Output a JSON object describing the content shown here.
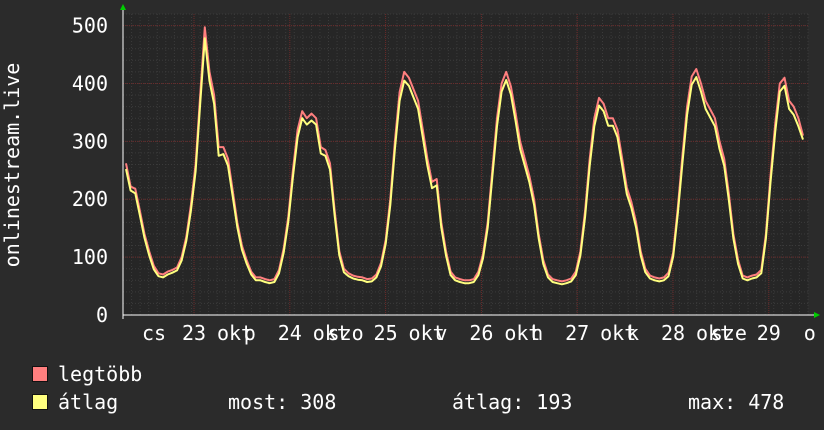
{
  "chart_data": {
    "type": "line",
    "ylabel": "onlinestream.live",
    "ylim": [
      0,
      520
    ],
    "y_ticks": [
      0,
      100,
      200,
      300,
      400,
      500
    ],
    "x_tick_labels": [
      "cs",
      "23",
      "okt",
      "p",
      "24",
      "okt",
      "szo",
      "25",
      "okt",
      "v",
      "26",
      "okt",
      "h",
      "27",
      "okt",
      "k",
      "28",
      "okt",
      "sze",
      "29",
      "o"
    ],
    "grid": true,
    "legend_placement": "bottom",
    "series": [
      {
        "name": "legtöbb",
        "color": "#ff7f7f",
        "values": [
          262,
          222,
          218,
          180,
          140,
          110,
          85,
          72,
          70,
          75,
          78,
          82,
          100,
          135,
          190,
          260,
          380,
          497,
          420,
          380,
          290,
          290,
          270,
          215,
          160,
          120,
          95,
          75,
          65,
          65,
          62,
          60,
          62,
          78,
          115,
          170,
          250,
          320,
          352,
          340,
          348,
          340,
          290,
          285,
          262,
          180,
          110,
          80,
          72,
          68,
          66,
          65,
          62,
          63,
          70,
          90,
          130,
          200,
          300,
          385,
          420,
          410,
          390,
          370,
          320,
          270,
          230,
          235,
          160,
          110,
          75,
          65,
          62,
          60,
          60,
          62,
          75,
          105,
          160,
          250,
          340,
          400,
          420,
          395,
          350,
          300,
          270,
          240,
          200,
          140,
          95,
          70,
          62,
          60,
          58,
          60,
          63,
          75,
          110,
          180,
          270,
          340,
          375,
          365,
          340,
          340,
          320,
          270,
          220,
          195,
          160,
          110,
          80,
          68,
          65,
          63,
          65,
          73,
          108,
          185,
          275,
          360,
          412,
          425,
          400,
          370,
          355,
          340,
          300,
          270,
          210,
          140,
          95,
          68,
          65,
          68,
          70,
          78,
          140,
          240,
          330,
          400,
          410,
          370,
          360,
          340,
          310
        ],
        "dashed": false
      },
      {
        "name": "átlag",
        "color": "#ffff7f",
        "values": [
          252,
          215,
          210,
          172,
          133,
          103,
          79,
          67,
          65,
          70,
          73,
          77,
          94,
          128,
          180,
          248,
          365,
          478,
          404,
          365,
          275,
          278,
          258,
          205,
          152,
          113,
          89,
          70,
          60,
          60,
          57,
          55,
          57,
          72,
          108,
          161,
          238,
          307,
          340,
          329,
          336,
          329,
          279,
          275,
          251,
          171,
          103,
          74,
          67,
          63,
          61,
          60,
          57,
          58,
          65,
          84,
          123,
          190,
          287,
          370,
          405,
          396,
          376,
          356,
          307,
          258,
          219,
          224,
          151,
          103,
          69,
          60,
          57,
          55,
          55,
          57,
          69,
          98,
          151,
          238,
          326,
          386,
          406,
          381,
          336,
          287,
          258,
          229,
          190,
          132,
          88,
          65,
          57,
          55,
          53,
          55,
          58,
          69,
          103,
          170,
          258,
          326,
          362,
          352,
          327,
          327,
          307,
          258,
          209,
          185,
          151,
          103,
          74,
          63,
          60,
          58,
          60,
          67,
          101,
          175,
          262,
          346,
          398,
          411,
          386,
          356,
          341,
          326,
          287,
          258,
          199,
          132,
          88,
          63,
          60,
          63,
          65,
          72,
          132,
          229,
          316,
          386,
          396,
          356,
          346,
          326,
          303
        ],
        "dashed": false
      }
    ]
  },
  "legend": {
    "max_label": "legtöbb",
    "avg_label": "átlag"
  },
  "stats": {
    "now": "most: 308",
    "avg": "átlag: 193",
    "max": "max: 478"
  },
  "colors": {
    "background": "#2b2b2b",
    "plot_background": "#262626",
    "grid_major": "#6b2a2a",
    "grid_minor": "#3b3b3b",
    "axis_arrow": "#00cc00"
  }
}
